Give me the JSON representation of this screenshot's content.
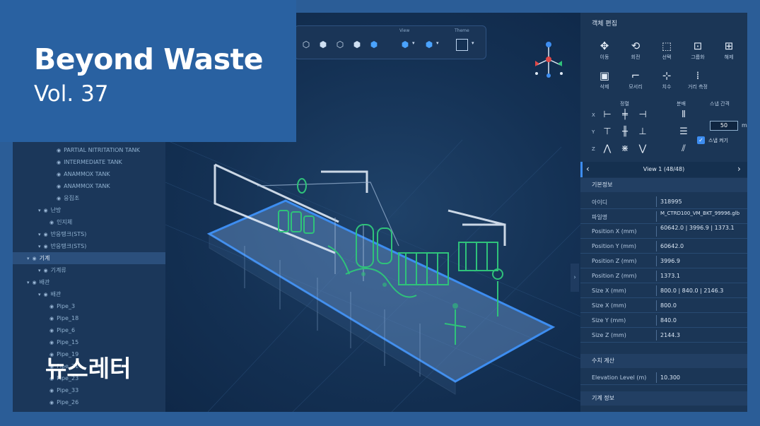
{
  "cover": {
    "title": "Beyond Waste",
    "volume": "Vol. 37",
    "newsletter_label": "뉴스레터"
  },
  "toolbar": {
    "group_label": "View",
    "theme_label": "Theme"
  },
  "tree": {
    "items": [
      {
        "label": "PARTIAL NITRITATION TANK",
        "level": 3
      },
      {
        "label": "INTERMEDIATE TANK",
        "level": 3
      },
      {
        "label": "ANAMMOX TANK",
        "level": 3
      },
      {
        "label": "ANAMMOX TANK",
        "level": 3
      },
      {
        "label": "응집조",
        "level": 3
      },
      {
        "label": "난방",
        "level": 1
      },
      {
        "label": "인지체",
        "level": 2
      },
      {
        "label": "반응탱크(STS)",
        "level": 1
      },
      {
        "label": "반응탱크(STS)",
        "level": 1
      },
      {
        "label": "기계",
        "level": 0,
        "selected": true
      },
      {
        "label": "기계류",
        "level": 1
      },
      {
        "label": "배관",
        "level": 0
      },
      {
        "label": "배관",
        "level": 1
      },
      {
        "label": "Pipe_3",
        "level": 2
      },
      {
        "label": "Pipe_18",
        "level": 2
      },
      {
        "label": "Pipe_6",
        "level": 2
      },
      {
        "label": "Pipe_15",
        "level": 2
      },
      {
        "label": "Pipe_19",
        "level": 2
      },
      {
        "label": "Pipe_21",
        "level": 2
      },
      {
        "label": "Pipe_23",
        "level": 2
      },
      {
        "label": "Pipe_33",
        "level": 2
      },
      {
        "label": "Pipe_26",
        "level": 2
      }
    ]
  },
  "panel": {
    "title": "객체 편집",
    "tools_row1": [
      {
        "icon": "move-icon",
        "glyph": "✥",
        "label": "이동"
      },
      {
        "icon": "rotate-icon",
        "glyph": "⟲",
        "label": "회전"
      },
      {
        "icon": "select-icon",
        "glyph": "⬚",
        "label": "선택"
      },
      {
        "icon": "group-icon",
        "glyph": "⊡",
        "label": "그룹화"
      },
      {
        "icon": "ungroup-icon",
        "glyph": "⊞",
        "label": "해제"
      }
    ],
    "tools_row2": [
      {
        "icon": "delete-icon",
        "glyph": "▣",
        "label": "삭제"
      },
      {
        "icon": "corner-icon",
        "glyph": "⌐",
        "label": "모서리"
      },
      {
        "icon": "measure-icon",
        "glyph": "⊹",
        "label": "치수"
      },
      {
        "icon": "distance-icon",
        "glyph": "⁞",
        "label": "거리 측정"
      }
    ],
    "align_header": "정렬",
    "distribute_header": "분배",
    "snap_header": "스냅 간격",
    "snap_value": "50",
    "snap_unit": "mm",
    "snap_toggle_label": "스냅 켜기",
    "axes": [
      "X",
      "Y",
      "Z"
    ],
    "view_label": "View 1 (48/48)",
    "section_basic": "기본정보",
    "properties": [
      {
        "key": "아이디",
        "value": "318995"
      },
      {
        "key": "파일명",
        "value": "M_CTRD100_VM_BKT_99996.glb"
      },
      {
        "key": "Position X (mm)",
        "value": "60642.0 | 3996.9 | 1373.1"
      },
      {
        "key": "Position Y (mm)",
        "value": "60642.0"
      },
      {
        "key": "Position Z (mm)",
        "value": "3996.9"
      },
      {
        "key": "Position Z (mm)",
        "value": "1373.1"
      },
      {
        "key": "Size X (mm)",
        "value": "800.0 | 840.0 | 2146.3"
      },
      {
        "key": "Size X (mm)",
        "value": "800.0"
      },
      {
        "key": "Size Y (mm)",
        "value": "840.0"
      },
      {
        "key": "Size Z (mm)",
        "value": "2144.3"
      }
    ],
    "section_calc": "수치 계산",
    "elevation": {
      "key": "Elevation Level (m)",
      "value": "10.300"
    },
    "section_machine": "기계 정보"
  }
}
